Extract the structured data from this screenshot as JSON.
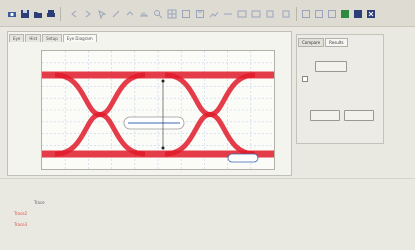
{
  "toolbar": {
    "buttons": [
      "camera-icon",
      "save-icon",
      "folder-icon",
      "print-icon",
      "settings-icon",
      "arrow-left-icon",
      "arrow-right-icon",
      "cursor-icon",
      "measure-icon",
      "zoom-icon",
      "grid-icon",
      "marker-icon",
      "chart-icon",
      "window-icon",
      "close-icon"
    ]
  },
  "graph": {
    "tabs": [
      "Eye",
      "Hist",
      "Setup",
      "Eye Diagram"
    ],
    "y_labels": [
      "",
      "",
      "",
      "",
      "",
      "",
      "",
      "",
      "",
      "",
      "",
      ""
    ],
    "x_labels": [
      "",
      "",
      "",
      "",
      "",
      "",
      ""
    ]
  },
  "right": {
    "tabs": [
      "Compare",
      "Results"
    ],
    "heading": "",
    "measure_button": "",
    "checkbox_label": "",
    "footer_heading": "",
    "btn1": "",
    "btn2": ""
  },
  "info": {
    "col1": [
      "Trace",
      "Trace2",
      "Trace3"
    ],
    "col2": [
      "",
      "",
      ""
    ],
    "col3": [
      "",
      "",
      ""
    ],
    "col4": [
      "",
      "",
      ""
    ]
  },
  "colors": {
    "eye": "#e11a2a",
    "grid": "#c5d3ea",
    "accent": "#3a67b0"
  }
}
